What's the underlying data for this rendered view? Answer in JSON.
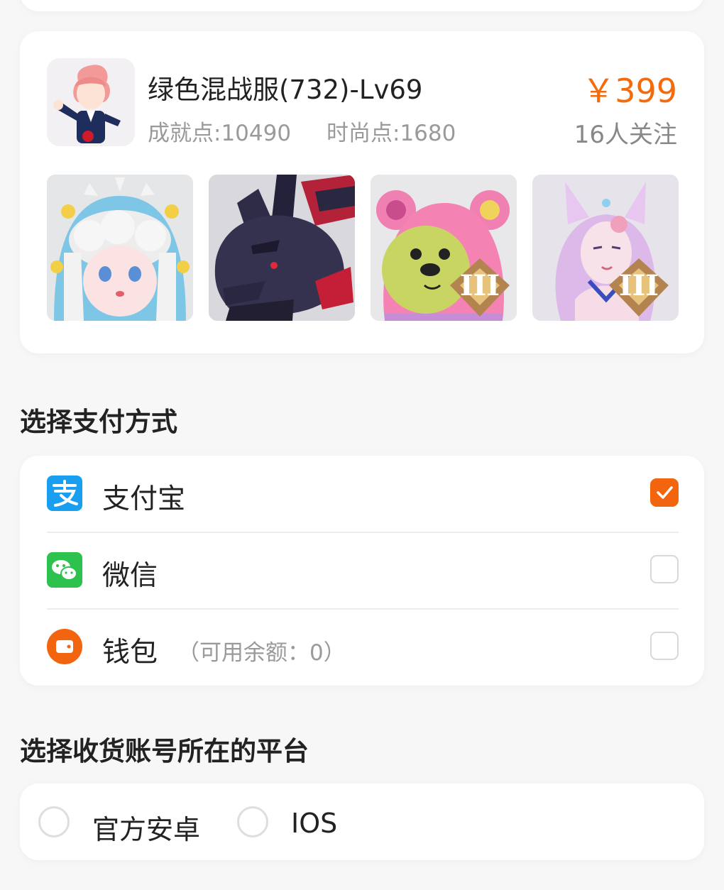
{
  "product": {
    "title": "绿色混战服(732)-Lv69",
    "achievement": "成就点:10490",
    "fashion": "时尚点:1680",
    "price": "￥399",
    "followers": "16人关注",
    "thumbnails": [
      {
        "name": "cloud-hair-doll",
        "badge": ""
      },
      {
        "name": "dark-dragon",
        "badge": ""
      },
      {
        "name": "pink-bear",
        "badge": "III"
      },
      {
        "name": "fox-spirit",
        "badge": "III"
      }
    ]
  },
  "payment": {
    "section_title": "选择支付方式",
    "options": [
      {
        "label": "支付宝",
        "sub": "",
        "icon": "alipay-icon",
        "checked": true
      },
      {
        "label": "微信",
        "sub": "",
        "icon": "wechat-icon",
        "checked": false
      },
      {
        "label": "钱包",
        "sub": "（可用余额：0）",
        "icon": "wallet-icon",
        "checked": false
      }
    ]
  },
  "platform": {
    "section_title": "选择收货账号所在的平台",
    "options": [
      {
        "label": "官方安卓",
        "selected": false
      },
      {
        "label": "IOS",
        "selected": false
      }
    ]
  },
  "colors": {
    "accent": "#f3640f",
    "price": "#f36b0d",
    "alipay": "#1a9ff0",
    "wechat": "#2dc24e"
  }
}
